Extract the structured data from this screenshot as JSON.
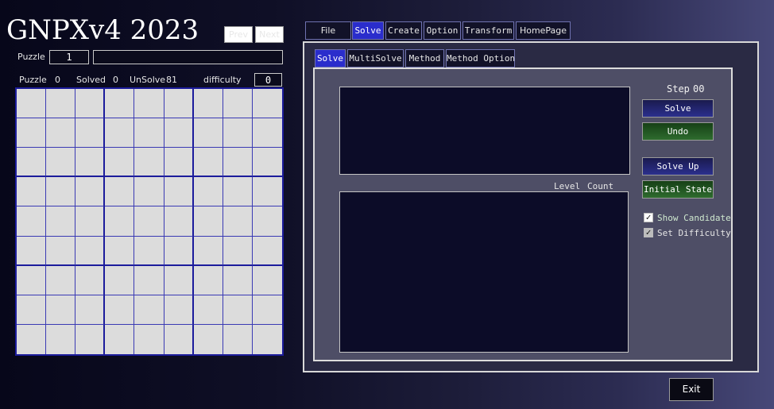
{
  "app": {
    "title": "GNPXv4 2023"
  },
  "nav": {
    "prev_label": "Prev",
    "next_label": "Next"
  },
  "puzzle": {
    "label": "Puzzle",
    "number": "1",
    "name": "",
    "stats": {
      "puzzle_label": "Puzzle",
      "puzzle_value": "0",
      "solved_label": "Solved",
      "solved_value": "0",
      "unsolve_label": "UnSolve",
      "unsolve_value": "81",
      "difficulty_label": "difficulty",
      "difficulty_value": "0"
    }
  },
  "main_tabs": [
    {
      "label": "File"
    },
    {
      "label": "Solve",
      "active": true
    },
    {
      "label": "Create"
    },
    {
      "label": "Option"
    },
    {
      "label": "Transform"
    },
    {
      "label": "HomePage"
    }
  ],
  "sub_tabs": [
    {
      "label": "Solve",
      "active": true
    },
    {
      "label": "MultiSolve"
    },
    {
      "label": "Method"
    },
    {
      "label": "Method Option"
    }
  ],
  "solve_panel": {
    "step_label": "Step",
    "step_value": "00",
    "level_label": "Level",
    "count_label": "Count",
    "solve_button": "Solve",
    "undo_button": "Undo",
    "solve_up_button": "Solve Up",
    "initial_state_button": "Initial State",
    "show_candidate_label": "Show Candidate",
    "show_candidate_checked": true,
    "set_difficulty_label": "Set Difficulty",
    "set_difficulty_checked": true
  },
  "exit_button": "Exit",
  "colors": {
    "accent_tab": "#2a2dcc",
    "grid_line": "#1c1c9c",
    "cell_bg": "#dcdcdc",
    "screen_bg": "#0c0c28",
    "green_button": "#2e6c2e",
    "blue_button": "#2b2f8e",
    "show_candidate_text": "#cfe8cf"
  }
}
